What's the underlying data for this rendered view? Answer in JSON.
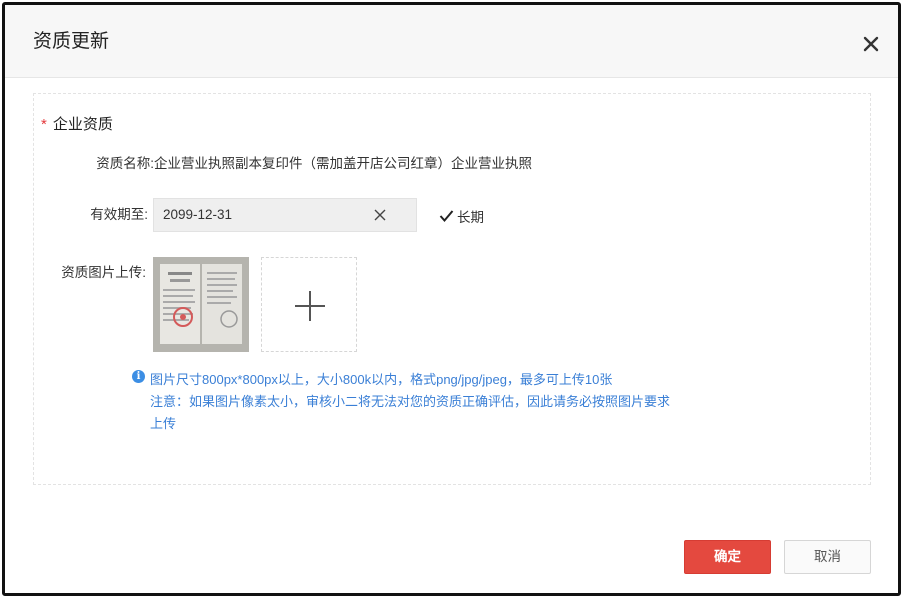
{
  "dialog": {
    "title": "资质更新",
    "close_icon": "close-icon"
  },
  "section": {
    "required_mark": "*",
    "title": "企业资质"
  },
  "fields": {
    "name_label": "资质名称:",
    "name_value": "企业营业执照副本复印件（需加盖开店公司红章）企业营业执照",
    "expiry_label": "有效期至:",
    "expiry_value": "2099-12-31",
    "long_term_label": "长期",
    "long_term_checked": true,
    "upload_label": "资质图片上传:"
  },
  "hints": {
    "line1": "图片尺寸800px*800px以上，大小800k以内，格式png/jpg/jpeg，最多可上传10张",
    "line2": "注意：如果图片像素太小，审核小二将无法对您的资质正确评估，因此请务必按照图片要求",
    "line3": "上传"
  },
  "buttons": {
    "confirm": "确定",
    "cancel": "取消"
  },
  "colors": {
    "accent": "#e4493f",
    "hint": "#3a7fd6",
    "required": "#e4393c"
  }
}
